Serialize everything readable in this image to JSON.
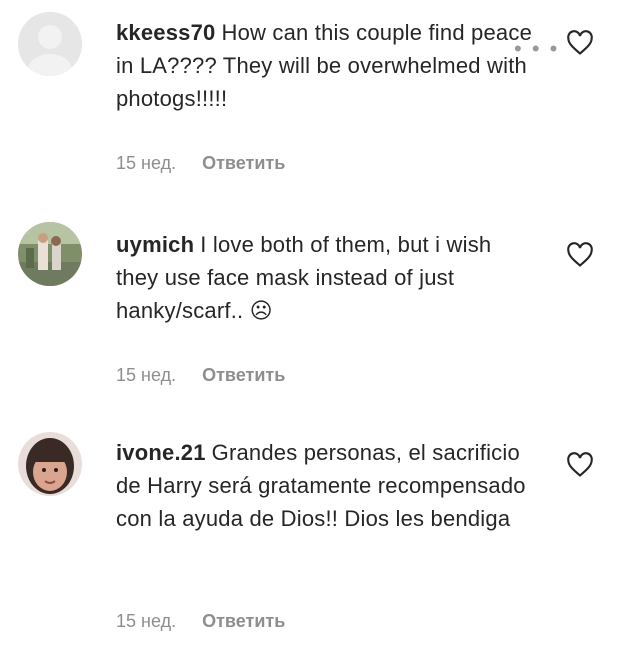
{
  "comments": [
    {
      "username": "kkeess70",
      "text": "How can this couple find peace in LA???? They will be overwhelmed with photogs!!!!!",
      "age": "15 нед.",
      "reply_label": "Ответить",
      "avatar": "default-avatar"
    },
    {
      "username": "uymich",
      "text": "I love both of them, but i wish they use face mask instead of just hanky/scarf.. ☹",
      "age": "15 нед.",
      "reply_label": "Ответить",
      "avatar": "photo-avatar"
    },
    {
      "username": "ivone.21",
      "text": "Grandes personas, el sacrificio de Harry será gratamente recompensado con la ayuda de Dios!! Dios les bendiga",
      "age": "15 нед.",
      "reply_label": "Ответить",
      "avatar": "photo-avatar"
    }
  ],
  "more_glyph": "• • •",
  "colors": {
    "text": "#262626",
    "secondary": "#8e8e8e"
  }
}
